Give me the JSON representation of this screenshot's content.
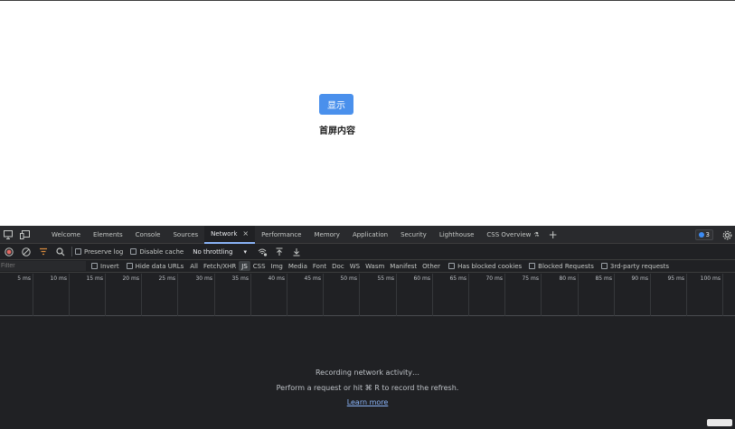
{
  "page": {
    "button_label": "显示",
    "content_text": "首屏内容"
  },
  "devtools": {
    "tabs": [
      {
        "label": "Welcome"
      },
      {
        "label": "Elements"
      },
      {
        "label": "Console"
      },
      {
        "label": "Sources"
      },
      {
        "label": "Network",
        "active": true,
        "close": "×"
      },
      {
        "label": "Performance"
      },
      {
        "label": "Memory"
      },
      {
        "label": "Application"
      },
      {
        "label": "Security"
      },
      {
        "label": "Lighthouse"
      },
      {
        "label": "CSS Overview",
        "icon": "flask-icon"
      }
    ],
    "issues_count": "3",
    "toolbar": {
      "preserve_log": "Preserve log",
      "disable_cache": "Disable cache",
      "throttling": "No throttling"
    },
    "filter": {
      "placeholder": "Filter",
      "invert": "Invert",
      "hide_data_urls": "Hide data URLs",
      "types": [
        "All",
        "Fetch/XHR",
        "JS",
        "CSS",
        "Img",
        "Media",
        "Font",
        "Doc",
        "WS",
        "Wasm",
        "Manifest",
        "Other"
      ],
      "active_type": "JS",
      "has_blocked_cookies": "Has blocked cookies",
      "blocked_requests": "Blocked Requests",
      "third_party": "3rd-party requests"
    },
    "timeline_ticks": [
      "5 ms",
      "10 ms",
      "15 ms",
      "20 ms",
      "25 ms",
      "30 ms",
      "35 ms",
      "40 ms",
      "45 ms",
      "50 ms",
      "55 ms",
      "60 ms",
      "65 ms",
      "70 ms",
      "75 ms",
      "80 ms",
      "85 ms",
      "90 ms",
      "95 ms",
      "100 ms"
    ],
    "empty_state": {
      "title": "Recording network activity…",
      "hint": "Perform a request or hit ⌘ R to record the refresh.",
      "link": "Learn more"
    }
  },
  "colors": {
    "button_blue": "#4a90ec",
    "devtools_bg": "#202124",
    "link": "#8ab4f8"
  }
}
